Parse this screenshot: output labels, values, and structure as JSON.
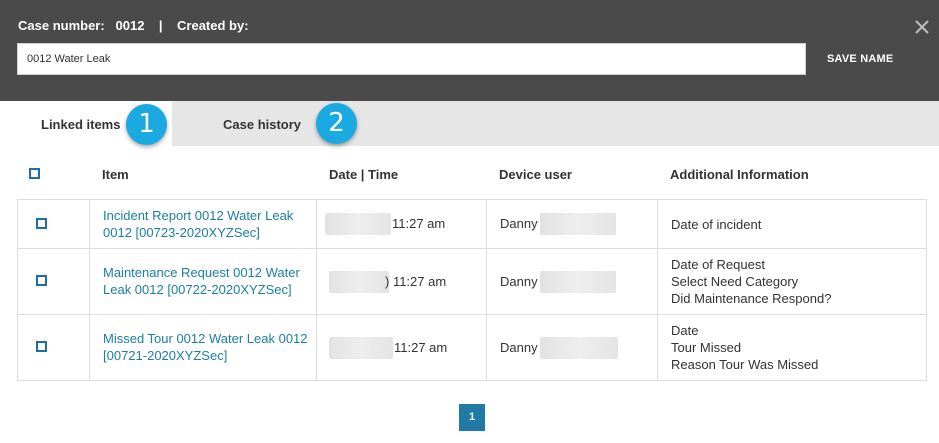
{
  "header": {
    "case_number_label": "Case number:",
    "case_number": "0012",
    "separator": "|",
    "created_by_label": "Created by:",
    "name_value": "0012 Water Leak",
    "save_label": "SAVE NAME"
  },
  "tabs": [
    {
      "label": "Linked items",
      "badge": "1",
      "active": true
    },
    {
      "label": "Case history",
      "badge": "2",
      "active": false
    }
  ],
  "table": {
    "columns": [
      "Item",
      "Date | Time",
      "Device user",
      "Additional Information"
    ],
    "rows": [
      {
        "item": "Incident Report 0012 Water Leak 0012 [00723-2020XYZSec]",
        "time": "11:27 am",
        "user": "Danny",
        "info": [
          "Date of incident"
        ]
      },
      {
        "item": "Maintenance Request 0012 Water Leak 0012 [00722-2020XYZSec]",
        "time": ") 11:27 am",
        "user": "Danny",
        "info": [
          "Date of Request",
          "Select Need Category",
          "Did Maintenance Respond?"
        ]
      },
      {
        "item": "Missed Tour 0012 Water Leak 0012 [00721-2020XYZSec]",
        "time": "11:27 am",
        "user": "Danny",
        "info": [
          "Date",
          "Tour Missed",
          "Reason Tour Was Missed"
        ]
      }
    ]
  },
  "pagination": {
    "current": "1"
  },
  "colors": {
    "header_bg": "#4a4a4a",
    "accent_badge": "#1aa9e0",
    "link": "#1a7fa5",
    "pager": "#1f7aa6"
  },
  "icons": {
    "close": "close-icon",
    "checkbox": "checkbox-icon"
  }
}
